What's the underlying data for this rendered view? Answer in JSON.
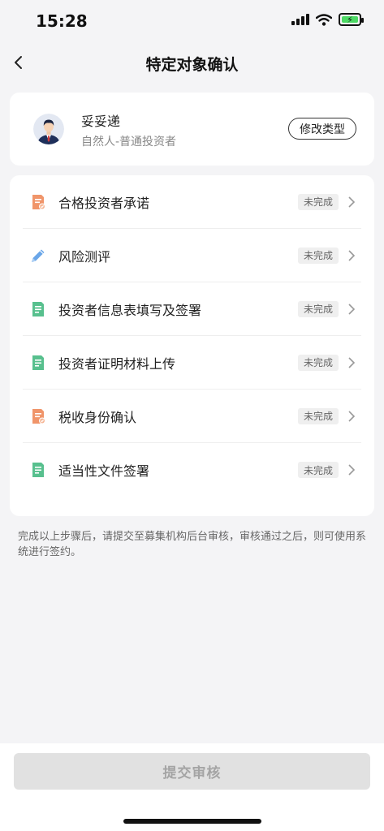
{
  "status_bar": {
    "time": "15:28"
  },
  "nav": {
    "title": "特定对象确认",
    "back_icon": "chevron-left-icon"
  },
  "profile": {
    "name": "妥妥递",
    "type": "自然人-普通投资者",
    "modify_label": "修改类型"
  },
  "steps": [
    {
      "label": "合格投资者承诺",
      "status": "未完成",
      "icon": "orange-document-check-icon"
    },
    {
      "label": "风险测评",
      "status": "未完成",
      "icon": "pencil-icon"
    },
    {
      "label": "投资者信息表填写及签署",
      "status": "未完成",
      "icon": "green-document-icon"
    },
    {
      "label": "投资者证明材料上传",
      "status": "未完成",
      "icon": "green-document-icon"
    },
    {
      "label": "税收身份确认",
      "status": "未完成",
      "icon": "orange-document-check-icon"
    },
    {
      "label": "适当性文件签署",
      "status": "未完成",
      "icon": "green-document-icon"
    }
  ],
  "notice": "完成以上步骤后，请提交至募集机构后台审核，审核通过之后，则可使用系统进行签约。",
  "footer": {
    "submit_label": "提交审核"
  },
  "colors": {
    "background": "#f4f4f6",
    "card": "#ffffff",
    "orange_icon": "#f0956a",
    "green_icon": "#58c08e",
    "blue_icon": "#6aa6e8",
    "disabled_button": "#e1e1e1",
    "disabled_text": "#a4a4a4"
  }
}
